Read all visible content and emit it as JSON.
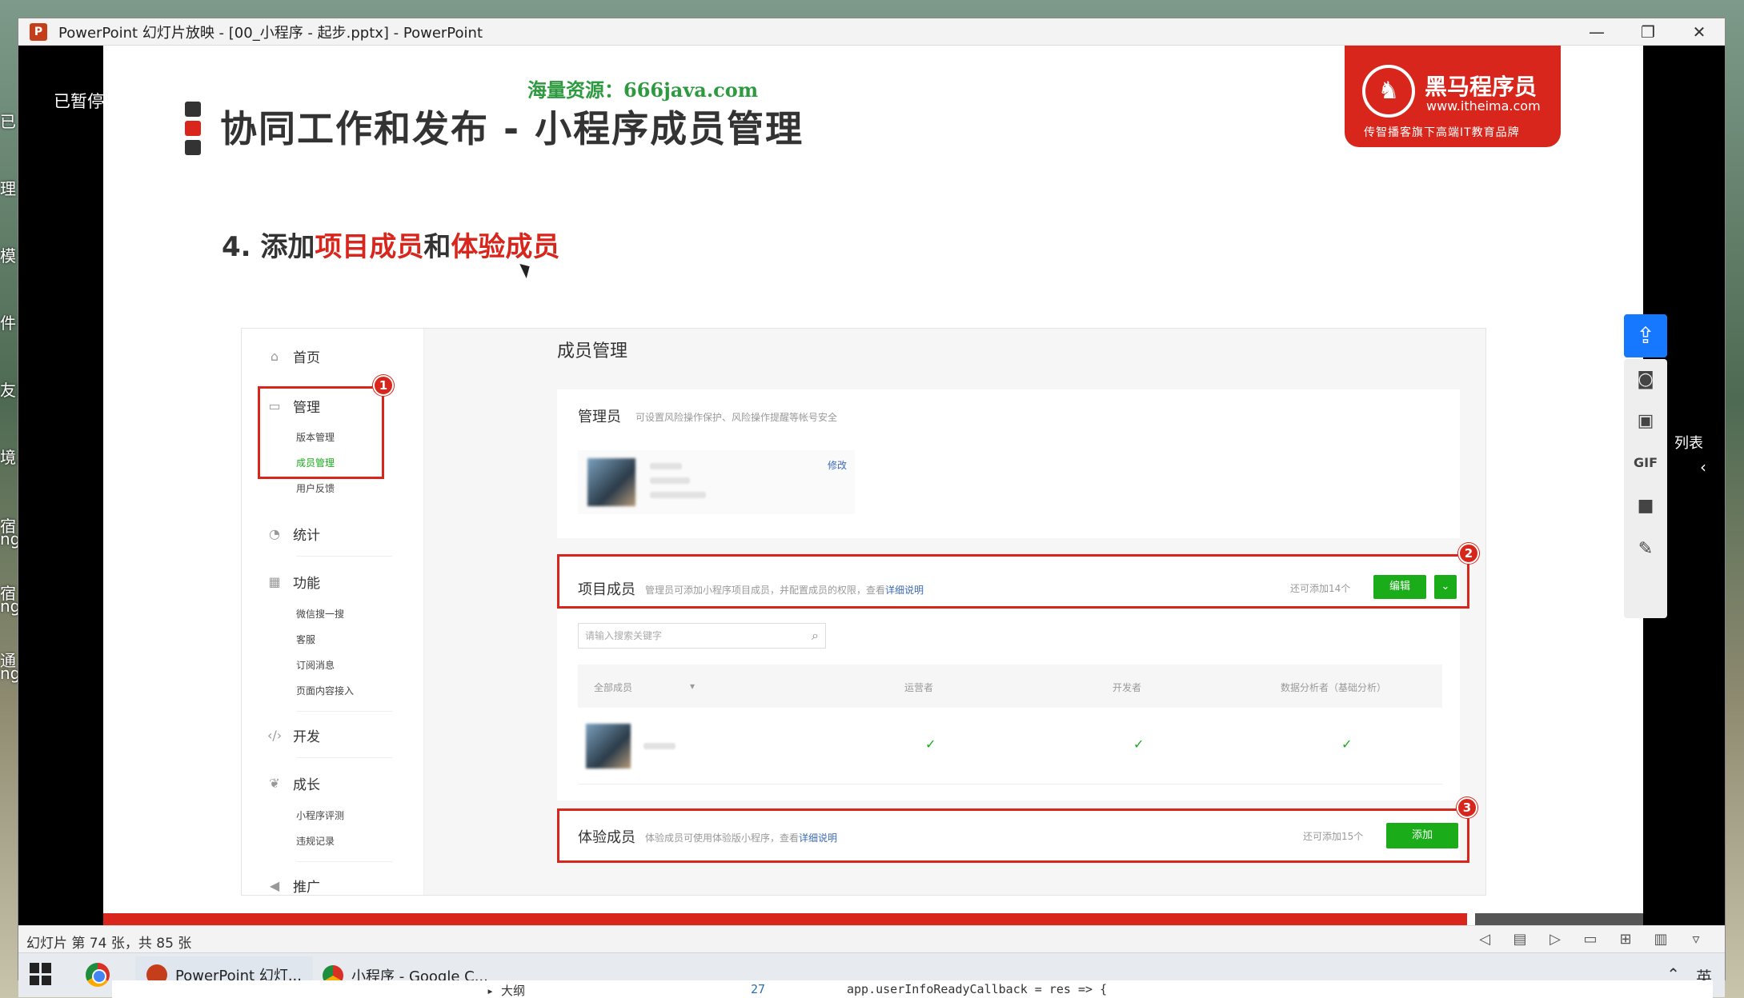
{
  "window": {
    "title": "PowerPoint 幻灯片放映 - [00_小程序 - 起步.pptx] - PowerPoint",
    "app_icon": "P",
    "controls": [
      "—",
      "❐",
      "✕"
    ]
  },
  "desktop": {
    "left_fragments": [
      "已",
      "理",
      "模",
      "件",
      "友目",
      "境.",
      "宿",
      "ng",
      "宿",
      "ng",
      "通",
      "ng"
    ],
    "right_fragment": "列表"
  },
  "presenter": {
    "paused_label": "已暂停"
  },
  "slide": {
    "watermark": "海量资源：666java.com",
    "title": "协同工作和发布 - 小程序成员管理",
    "logo": {
      "name": "黑马程序员",
      "url": "www.itheima.com",
      "slogan": "传智播客旗下高端IT教育品牌"
    },
    "subtitle": {
      "prefix": "4. 添加",
      "part1": "项目成员",
      "mid": "和",
      "part2": "体验成员"
    },
    "colors": {
      "accent_red": "#d8261c",
      "green": "#1aad19",
      "title_bars": [
        "#333333",
        "#d8261c",
        "#333333"
      ]
    },
    "mock": {
      "sidebar": {
        "home": "首页",
        "manage": "管理",
        "manage_subs": [
          "版本管理",
          "成员管理",
          "用户反馈"
        ],
        "stats": "统计",
        "features": "功能",
        "feature_subs": [
          "微信搜一搜",
          "客服",
          "订阅消息",
          "页面内容接入"
        ],
        "dev": "开发",
        "growth": "成长",
        "growth_subs": [
          "小程序评测",
          "违规记录"
        ],
        "promo": "推广"
      },
      "page_title": "成员管理",
      "admin": {
        "label": "管理员",
        "desc": "可设置风险操作保护、风险操作提醒等帐号安全",
        "edit": "修改"
      },
      "project": {
        "label": "项目成员",
        "desc": "管理员可添加小程序项目成员，并配置成员的权限，查看",
        "link": "详细说明",
        "quota": "还可添加14个",
        "edit_btn": "编辑",
        "search_placeholder": "请输入搜索关键字",
        "columns": [
          "全部成员",
          "运营者",
          "开发者",
          "数据分析者（基础分析）"
        ],
        "check": "✓"
      },
      "trial": {
        "label": "体验成员",
        "desc": "体验成员可使用体验版小程序，查看",
        "link": "详细说明",
        "quota": "还可添加15个",
        "add_btn": "添加"
      },
      "badges": [
        "1",
        "2",
        "3"
      ]
    }
  },
  "statusbar": {
    "slide_count": "幻灯片 第 74 张，共 85 张"
  },
  "taskbar": {
    "tasks": [
      {
        "label": "PowerPoint 幻灯..."
      },
      {
        "label": "小程序 - Google C..."
      }
    ],
    "ime": "英"
  },
  "code_strip": {
    "outline": "▸ 大纲",
    "line_no": "27",
    "code": "app.userInfoReadyCallback = res => {"
  }
}
